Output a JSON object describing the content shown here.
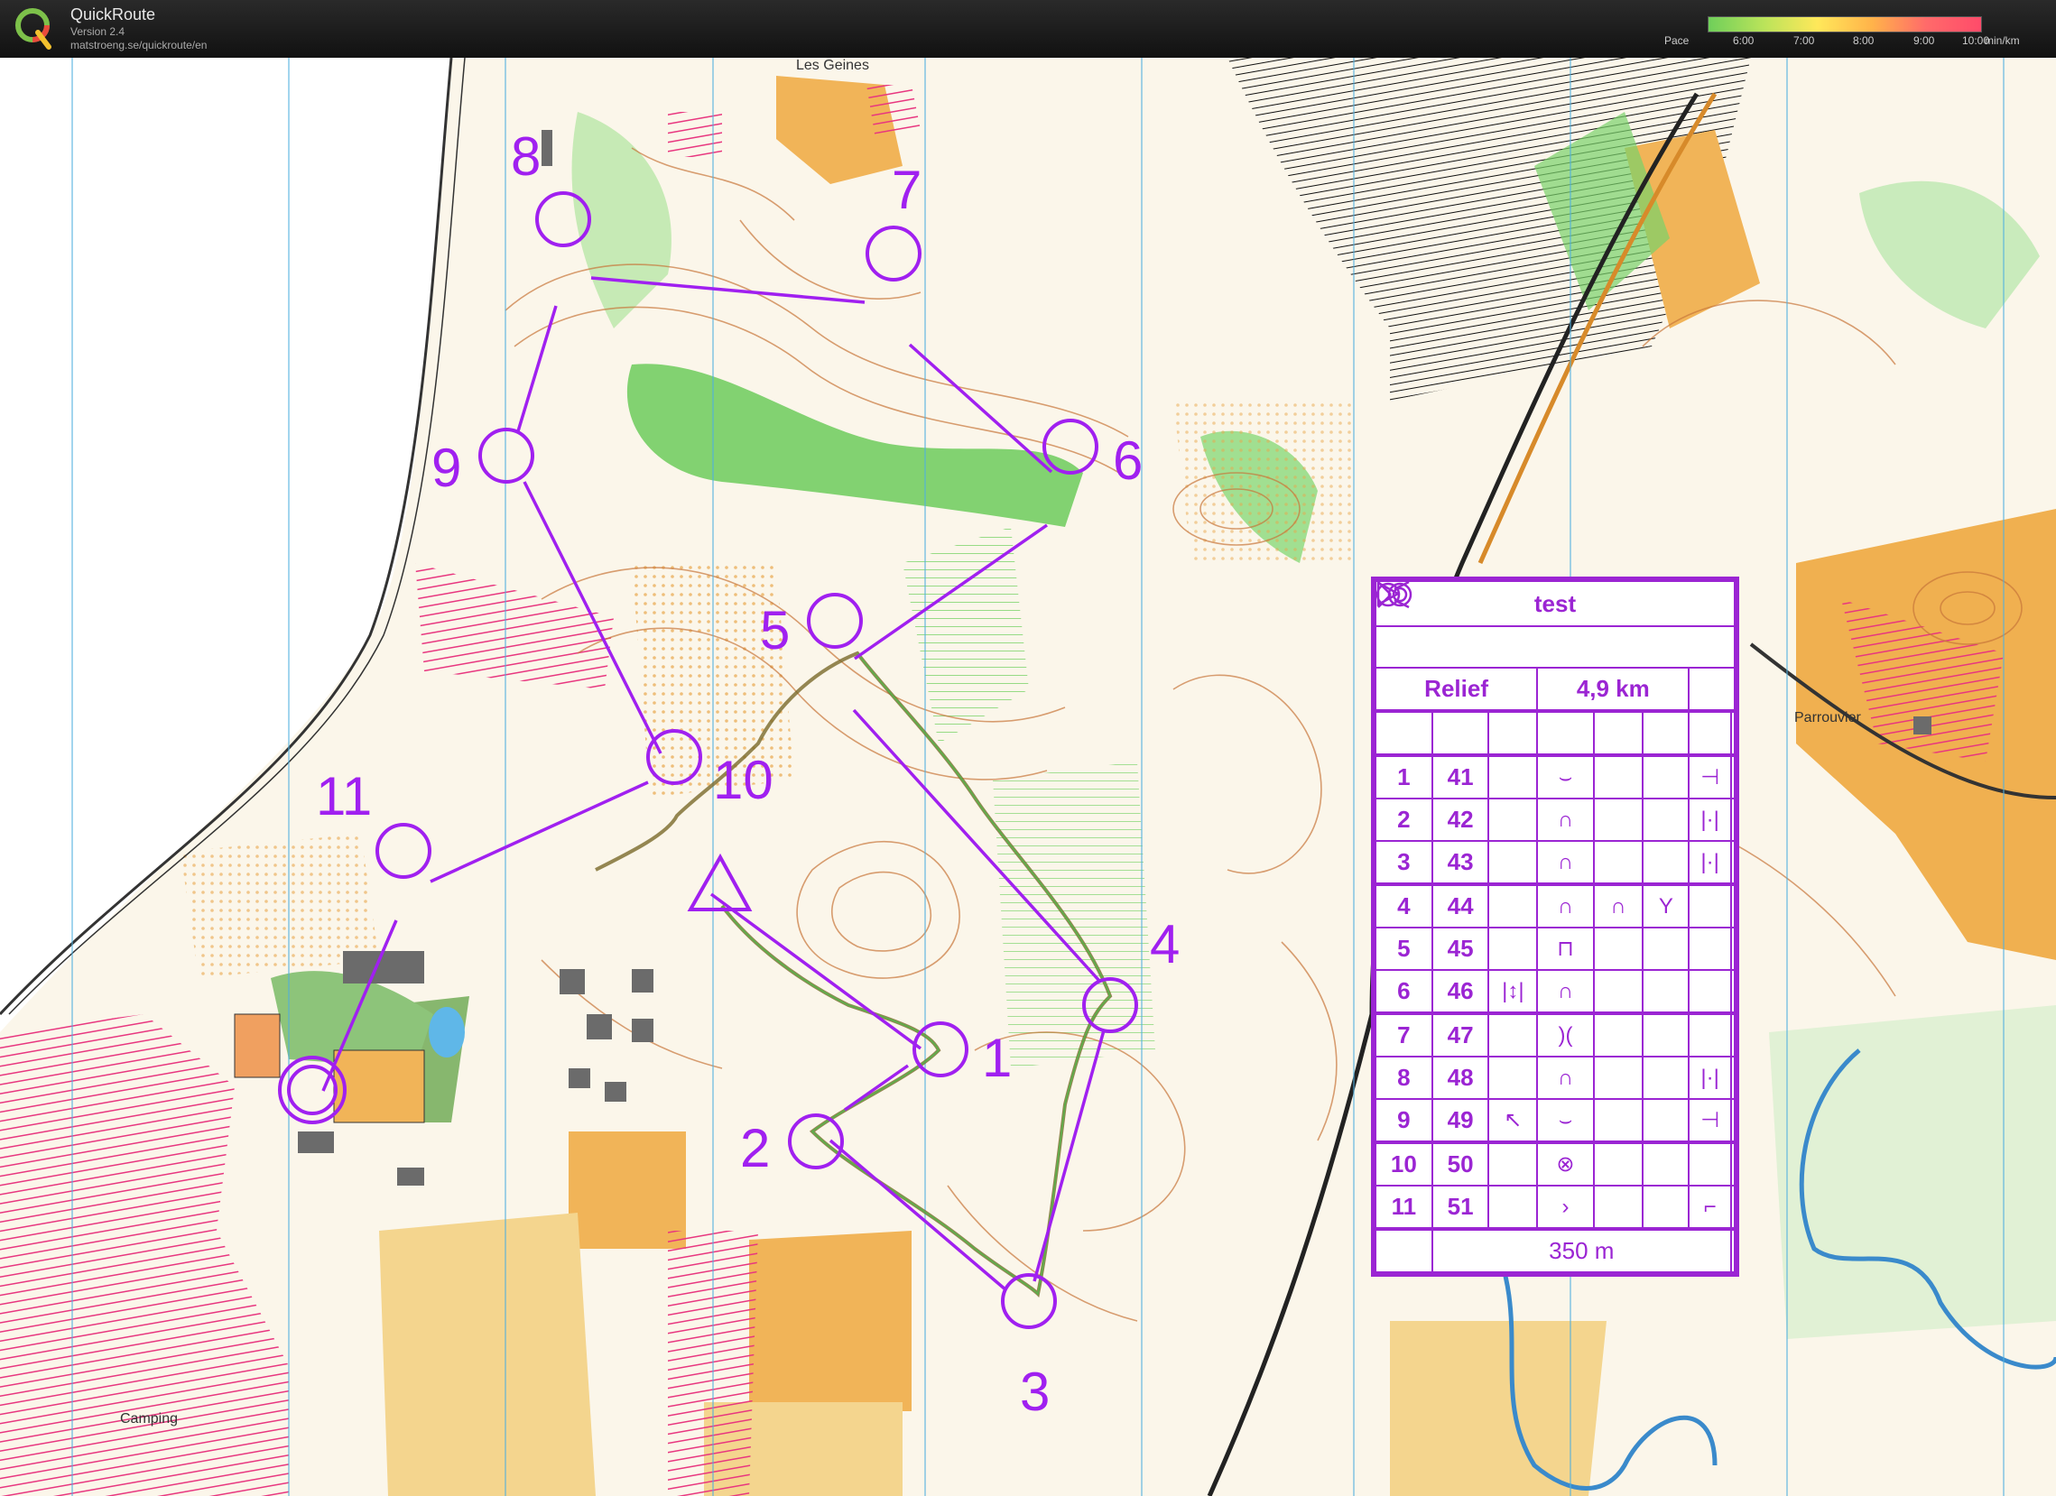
{
  "app": {
    "name": "QuickRoute",
    "version": "Version 2.4",
    "url": "matstroeng.se/quickroute/en"
  },
  "pace_legend": {
    "label": "Pace",
    "ticks": [
      "6:00",
      "7:00",
      "8:00",
      "9:00",
      "10:00"
    ],
    "unit": "min/km"
  },
  "map": {
    "place_names": [
      "Les Geines",
      "Parrouvier",
      "Camping"
    ],
    "controls": [
      "1",
      "2",
      "3",
      "4",
      "5",
      "6",
      "7",
      "8",
      "9",
      "10",
      "11"
    ],
    "course_color": "#a020f0"
  },
  "description_sheet": {
    "title": "test",
    "course": "Relief",
    "length": "4,9 km",
    "rows": [
      {
        "num": "1",
        "code": "41"
      },
      {
        "num": "2",
        "code": "42"
      },
      {
        "num": "3",
        "code": "43"
      },
      {
        "num": "4",
        "code": "44"
      },
      {
        "num": "5",
        "code": "45"
      },
      {
        "num": "6",
        "code": "46"
      },
      {
        "num": "7",
        "code": "47"
      },
      {
        "num": "8",
        "code": "48"
      },
      {
        "num": "9",
        "code": "49"
      },
      {
        "num": "10",
        "code": "50"
      },
      {
        "num": "11",
        "code": "51"
      }
    ],
    "finish_distance": "350 m"
  }
}
